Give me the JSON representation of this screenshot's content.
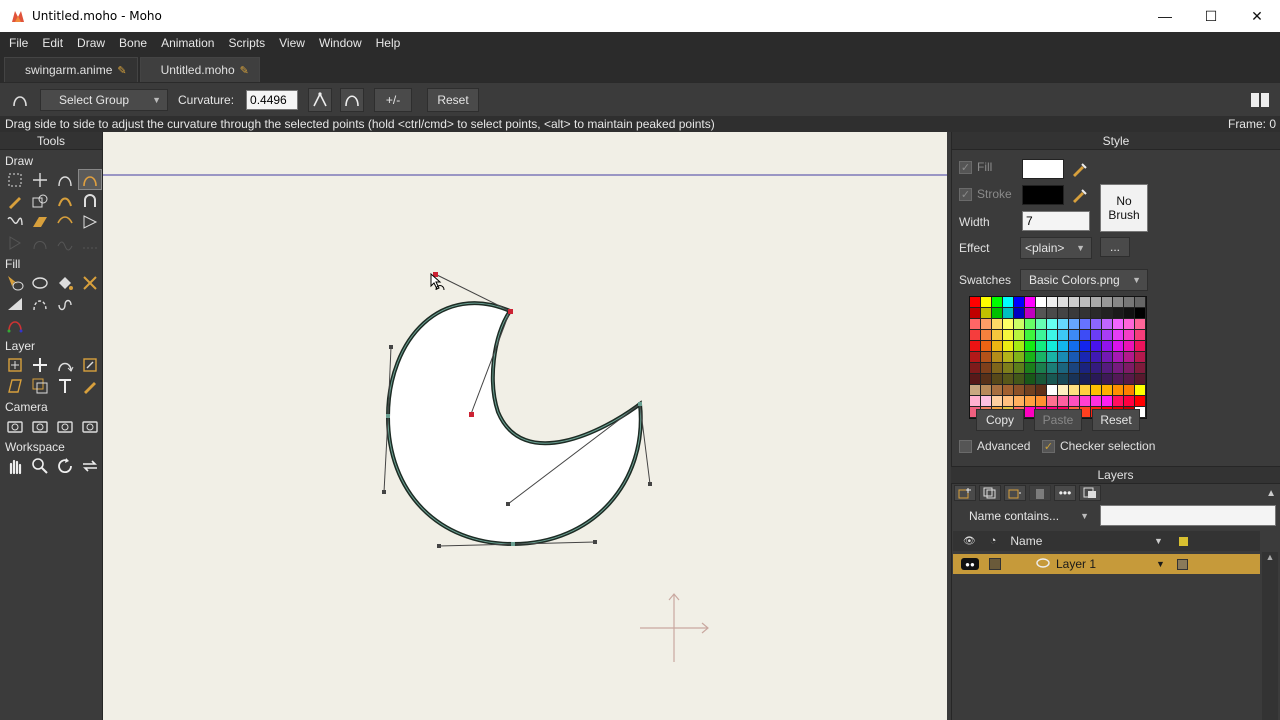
{
  "window": {
    "title": "Untitled.moho - Moho"
  },
  "menu": [
    "File",
    "Edit",
    "Draw",
    "Bone",
    "Animation",
    "Scripts",
    "View",
    "Window",
    "Help"
  ],
  "tabs": [
    {
      "label": "swingarm.anime"
    },
    {
      "label": "Untitled.moho"
    }
  ],
  "options": {
    "select_group": "Select Group",
    "curvature_label": "Curvature:",
    "curvature_value": "0.4496",
    "plus_minus": "+/-",
    "reset": "Reset"
  },
  "status": {
    "message": "Drag side to side to adjust the curvature through the selected points (hold <ctrl/cmd> to select points, <alt> to maintain peaked points)",
    "frame": "Frame: 0"
  },
  "tools_panel": {
    "title": "Tools",
    "sections": [
      "Draw",
      "Fill",
      "Layer",
      "Camera",
      "Workspace"
    ]
  },
  "style": {
    "title": "Style",
    "fill_label": "Fill",
    "stroke_label": "Stroke",
    "width_label": "Width",
    "width_value": "7",
    "effect_label": "Effect",
    "effect_value": "<plain>",
    "no_brush": "No Brush",
    "more": "...",
    "swatches_label": "Swatches",
    "swatches_value": "Basic Colors.png",
    "copy": "Copy",
    "paste": "Paste",
    "reset": "Reset",
    "advanced": "Advanced",
    "checker_selection": "Checker selection",
    "fill_color": "#ffffff",
    "stroke_color": "#000000"
  },
  "layers": {
    "title": "Layers",
    "filter": "Name contains...",
    "name_header": "Name",
    "items": [
      {
        "name": "Layer 1"
      }
    ]
  },
  "colors": {
    "accent": "#c69a3a",
    "selected_point": "#cc2233"
  }
}
